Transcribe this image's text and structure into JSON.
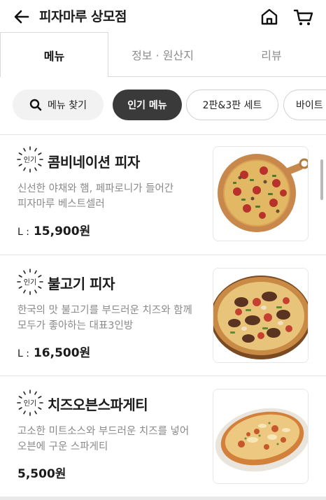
{
  "header": {
    "title": "피자마루 상모점",
    "back_icon": "arrow-left-icon",
    "home_icon": "home-icon",
    "cart_icon": "shopping-cart-icon"
  },
  "tabs": [
    {
      "label": "메뉴",
      "active": true
    },
    {
      "label": "정보 · 원산지",
      "active": false
    },
    {
      "label": "리뷰",
      "active": false
    }
  ],
  "chips": {
    "search_label": "메뉴 찾기",
    "search_icon": "search-icon",
    "items": [
      {
        "label": "인기 메뉴",
        "selected": true
      },
      {
        "label": "2판&3판 세트",
        "selected": false
      },
      {
        "label": "바이트",
        "selected": false
      }
    ]
  },
  "badge_text": "인기",
  "menu_items": [
    {
      "name": "콤비네이션 피자",
      "description": "신선한 야채와 햄, 페파로니가 들어간 피자마루 베스트셀러",
      "size": "L :",
      "price": "15,900원",
      "image": "combination-pizza-photo"
    },
    {
      "name": "불고기 피자",
      "description": "한국의 맛 불고기를 부드러운 치즈와 함께 모두가 좋아하는 대표3인방",
      "size": "L :",
      "price": "16,500원",
      "image": "bulgogi-pizza-photo"
    },
    {
      "name": "치즈오븐스파게티",
      "description": "고소한 미트소스와 부드러운 치즈를 넣어 오븐에 구운 스파게티",
      "size": "",
      "price": "5,500원",
      "image": "cheese-oven-spaghetti-photo"
    }
  ],
  "colors": {
    "selected_chip": "#3a3a3a",
    "chip_bg": "#f2f2f2",
    "muted_text": "#8a8a8a"
  }
}
